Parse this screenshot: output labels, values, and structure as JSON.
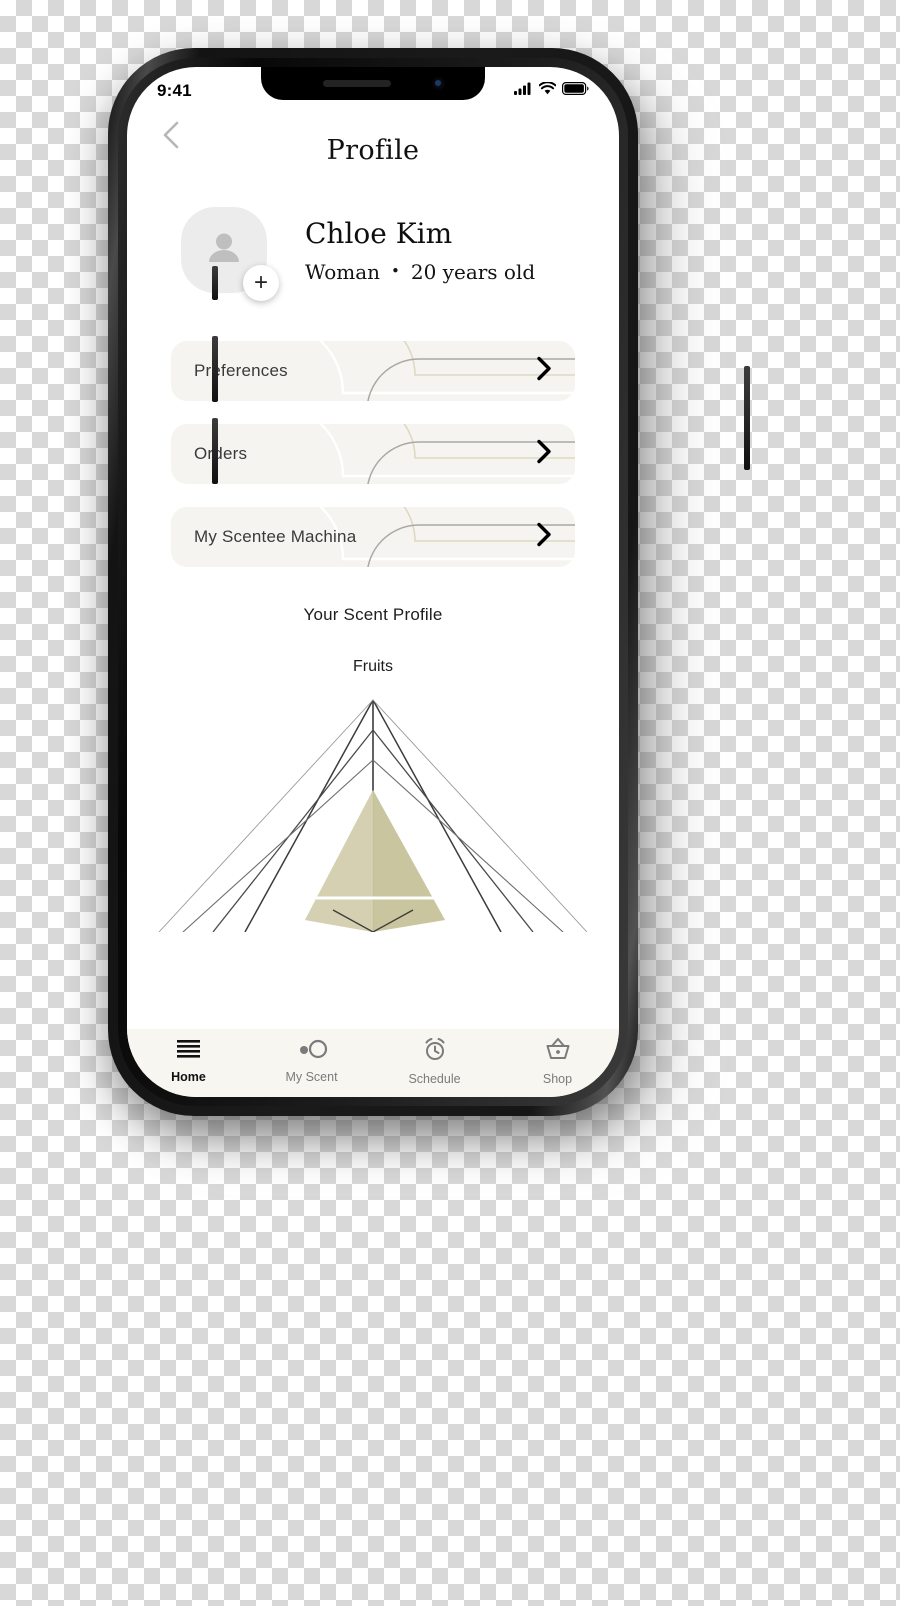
{
  "status_bar": {
    "time": "9:41",
    "icons": [
      "cellular-signal-icon",
      "wifi-icon",
      "battery-icon"
    ]
  },
  "nav": {
    "back_icon": "chevron-left-icon",
    "title": "Profile"
  },
  "profile": {
    "avatar_icon": "person-placeholder-icon",
    "add_photo_label": "+",
    "name": "Chloe Kim",
    "gender": "Woman",
    "separator": "•",
    "age": "20 years old"
  },
  "menu": {
    "items": [
      {
        "label": "Preferences",
        "chevron_icon": "chevron-right-icon"
      },
      {
        "label": "Orders",
        "chevron_icon": "chevron-right-icon"
      },
      {
        "label": "My Scentee Machina",
        "chevron_icon": "chevron-right-icon"
      }
    ]
  },
  "scent_profile": {
    "heading": "Your Scent Profile",
    "top_axis_label": "Fruits"
  },
  "chart_data": {
    "type": "radar",
    "title": "Your Scent Profile",
    "categories": [
      "Fruits"
    ],
    "visible_axis_labels": [
      "Fruits"
    ],
    "axis_count": 6,
    "ring_count": 4,
    "values": [
      0.62
    ],
    "rmax": 1,
    "fill_color": "#cdc9a5",
    "grid_color": "#3b3b3b",
    "note": "Radar chart is clipped by the bottom tab bar; only the upper apex region and the Fruits axis label are visible."
  },
  "tab_bar": {
    "items": [
      {
        "label": "Home",
        "icon": "hamburger-menu-icon",
        "active": true
      },
      {
        "label": "My Scent",
        "icon": "two-circles-icon",
        "active": false
      },
      {
        "label": "Schedule",
        "icon": "alarm-clock-icon",
        "active": false
      },
      {
        "label": "Shop",
        "icon": "shopping-basket-icon",
        "active": false
      }
    ]
  },
  "colors": {
    "card_background": "#f5f4f0",
    "tab_background": "#f7f6f1",
    "avatar_background": "#ececec",
    "accent_beige": "#d9d4b8",
    "chart_fill": "#cdc9a5",
    "text_primary": "#111111",
    "text_muted": "#7b7b7b"
  }
}
